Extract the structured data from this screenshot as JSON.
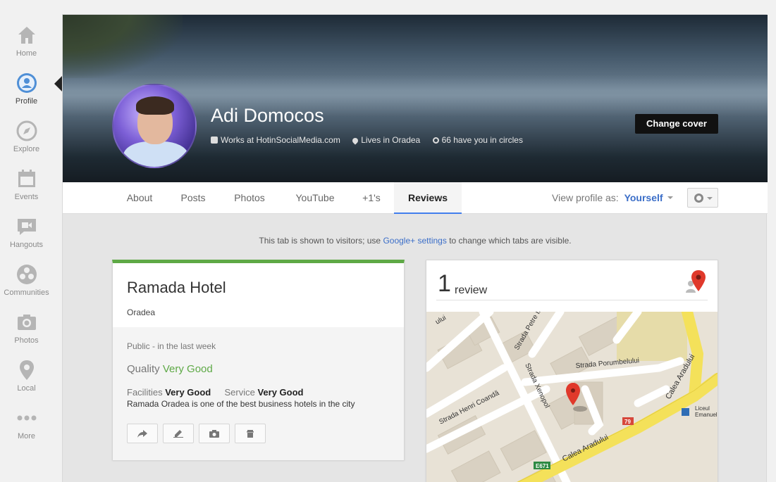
{
  "nav": {
    "items": [
      {
        "label": "Home",
        "icon": "home-icon"
      },
      {
        "label": "Profile",
        "icon": "profile-icon"
      },
      {
        "label": "Explore",
        "icon": "compass-icon"
      },
      {
        "label": "Events",
        "icon": "calendar-icon"
      },
      {
        "label": "Hangouts",
        "icon": "video-chat-icon"
      },
      {
        "label": "Communities",
        "icon": "communities-icon"
      },
      {
        "label": "Photos",
        "icon": "camera-icon"
      },
      {
        "label": "Local",
        "icon": "location-pin-icon"
      },
      {
        "label": "More",
        "icon": "more-dots-icon"
      }
    ],
    "active": "Profile"
  },
  "profile": {
    "name": "Adi Domocos",
    "works": "Works at HotinSocialMedia.com",
    "lives": "Lives in Oradea",
    "circles": "66 have you in circles",
    "change_cover": "Change cover"
  },
  "tabs": {
    "items": [
      "About",
      "Posts",
      "Photos",
      "YouTube",
      "+1's",
      "Reviews"
    ],
    "active": "Reviews",
    "view_as_label": "View profile as:",
    "view_as_value": "Yourself"
  },
  "notice": {
    "before": "This tab is shown to visitors; use ",
    "link": "Google+ settings",
    "after": " to change which tabs are visible."
  },
  "review": {
    "place": "Ramada Hotel",
    "city": "Oradea",
    "visibility": "Public",
    "when": "in the last week",
    "quality_label": "Quality",
    "quality_value": "Very Good",
    "facilities_label": "Facilities",
    "facilities_value": "Very Good",
    "service_label": "Service",
    "service_value": "Very Good",
    "text": "Ramada Oradea is one of the best business hotels in the city",
    "actions": [
      "share-icon",
      "edit-icon",
      "add-photo-icon",
      "delete-icon"
    ]
  },
  "summary": {
    "count": "1",
    "label": "review"
  },
  "map": {
    "streets": [
      "Strada Petre Ispirescu",
      "Strada Xenopol",
      "Strada Porumbelului",
      "Strada Henri Coandă",
      "Calea Aradului"
    ],
    "street_labels": {
      "petre": "Strada Petre Is",
      "xenopol": "Strada Xenopol",
      "porumbelului": "Strada Porumbelului",
      "coanda": "Strada Henri Coandă",
      "aradului_main": "Calea Aradului",
      "aradului_side": "Calea Aradului",
      "top_left": "ului"
    },
    "route_badges": [
      "79",
      "E671"
    ],
    "poi": "Liceul Emanuel",
    "poi_lines": [
      "Liceul",
      "Emanuel"
    ]
  },
  "colors": {
    "accent_blue": "#3b6ec8",
    "review_green": "#5ea946",
    "active_tab_underline": "#427fed"
  }
}
